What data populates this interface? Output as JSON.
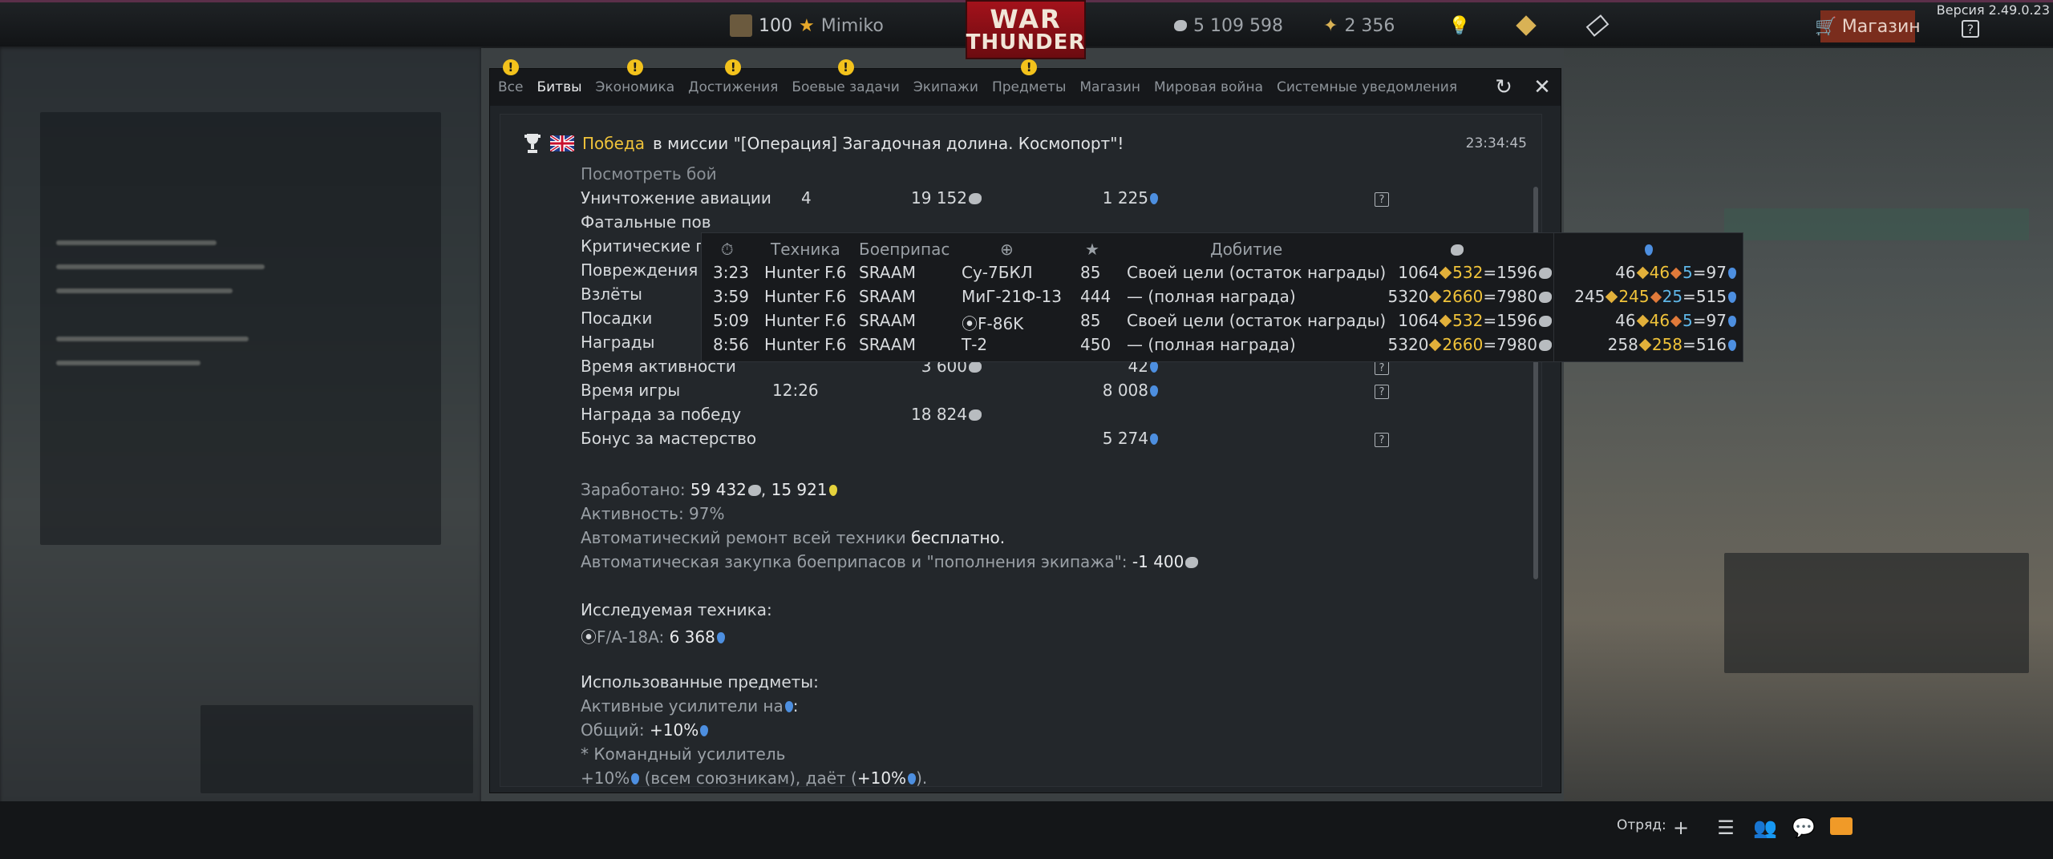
{
  "topbar": {
    "rank": "100",
    "player": "Mimiko",
    "lions": "5 109 598",
    "eagles": "2 356",
    "shop_label": "Магазин",
    "help": "?",
    "version": "Версия 2.49.0.23",
    "logo_line1": "WAR",
    "logo_line2": "THUNDER"
  },
  "tabs": [
    {
      "label": "Все",
      "warn": true
    },
    {
      "label": "Битвы",
      "warn": false,
      "active": true
    },
    {
      "label": "Экономика",
      "warn": true
    },
    {
      "label": "Достижения",
      "warn": true
    },
    {
      "label": "Боевые задачи",
      "warn": true
    },
    {
      "label": "Экипажи",
      "warn": false
    },
    {
      "label": "Предметы",
      "warn": true
    },
    {
      "label": "Магазин",
      "warn": false
    },
    {
      "label": "Мировая война",
      "warn": false
    },
    {
      "label": "Системные уведомления",
      "warn": false
    }
  ],
  "message": {
    "victory": "Победа",
    "text": "в миссии \"[Операция] Загадочная долина. Космопорт\"!",
    "time": "23:34:45",
    "view_battle": "Посмотреть бой"
  },
  "stats": [
    {
      "label": "Уничтожение авиации",
      "count": "4",
      "lions": "19 152",
      "rp": "1 225"
    },
    {
      "label": "Фатальные пов",
      "count": "",
      "lions": "",
      "rp": ""
    },
    {
      "label": "Критические по",
      "count": "",
      "lions": "",
      "rp": ""
    },
    {
      "label": "Повреждения п",
      "count": "",
      "lions": "",
      "rp": ""
    },
    {
      "label": "Взлёты",
      "count": "",
      "lions": "",
      "rp": ""
    },
    {
      "label": "Посадки",
      "count": "",
      "lions": "",
      "rp": ""
    },
    {
      "label": "Награды",
      "count": "",
      "lions": "",
      "rp": ""
    },
    {
      "label": "Время активности",
      "count": "",
      "lions": "3 600",
      "rp": "42"
    },
    {
      "label": "Время игры",
      "count": "12:26",
      "lions": "",
      "rp": "8 008"
    },
    {
      "label": "Награда за победу",
      "count": "",
      "lions": "18 824",
      "rp": ""
    },
    {
      "label": "Бонус за мастерство",
      "count": "",
      "lions": "",
      "rp": "5 274"
    }
  ],
  "summary": {
    "earned_label": "Заработано:",
    "earned_lions": "59 432",
    "earned_rp": "15 921",
    "activity_label": "Активность:",
    "activity_value": "97%",
    "repair_label": "Автоматический ремонт всей техники",
    "repair_value": "бесплатно.",
    "ammo_label": "Автоматическая закупка боеприпасов и \"пополнения экипажа\":",
    "ammo_value": "-1 400",
    "research_label": "Исследуемая техника:",
    "research_vehicle": "F/A-18A:",
    "research_value": "6 368",
    "items_label": "Использованные предметы:",
    "boosters_label": "Активные усилители на",
    "general_label": "Общий:",
    "general_value": "+10%",
    "cmd_label": "* Командный усилитель",
    "cmd_value": "+10%",
    "cmd_text": "(всем союзникам), даёт (",
    "cmd_value2": "+10%",
    "cmd_end": ")."
  },
  "tooltip": {
    "headers": {
      "vehicle": "Техника",
      "ammo": "Боеприпас",
      "kill": "Добитие"
    },
    "rows": [
      {
        "time": "3:23",
        "vehicle": "Hunter F.6",
        "ammo": "SRAAM",
        "target": "Су-7БКЛ",
        "br": "85",
        "kill": "Своей цели (остаток награды)",
        "l_base": "1064",
        "l_bonus": "532",
        "l_total": "1596",
        "r_base": "46",
        "r_b1": "46",
        "r_b2": "5",
        "r_total": "97"
      },
      {
        "time": "3:59",
        "vehicle": "Hunter F.6",
        "ammo": "SRAAM",
        "target": "МиГ-21Ф-13",
        "br": "444",
        "kill": "— (полная награда)",
        "l_base": "5320",
        "l_bonus": "2660",
        "l_total": "7980",
        "r_base": "245",
        "r_b1": "245",
        "r_b2": "25",
        "r_total": "515"
      },
      {
        "time": "5:09",
        "vehicle": "Hunter F.6",
        "ammo": "SRAAM",
        "target": "F-86K",
        "br": "85",
        "kill": "Своей цели (остаток награды)",
        "l_base": "1064",
        "l_bonus": "532",
        "l_total": "1596",
        "r_base": "46",
        "r_b1": "46",
        "r_b2": "5",
        "r_total": "97"
      },
      {
        "time": "8:56",
        "vehicle": "Hunter F.6",
        "ammo": "SRAAM",
        "target": "Т-2",
        "br": "450",
        "kill": "— (полная награда)",
        "l_base": "5320",
        "l_bonus": "2660",
        "l_total": "7980",
        "r_base": "258",
        "r_b1": "258",
        "r_b2": "",
        "r_total": "516"
      }
    ]
  },
  "bottombar": {
    "squad_label": "Отряд:"
  }
}
